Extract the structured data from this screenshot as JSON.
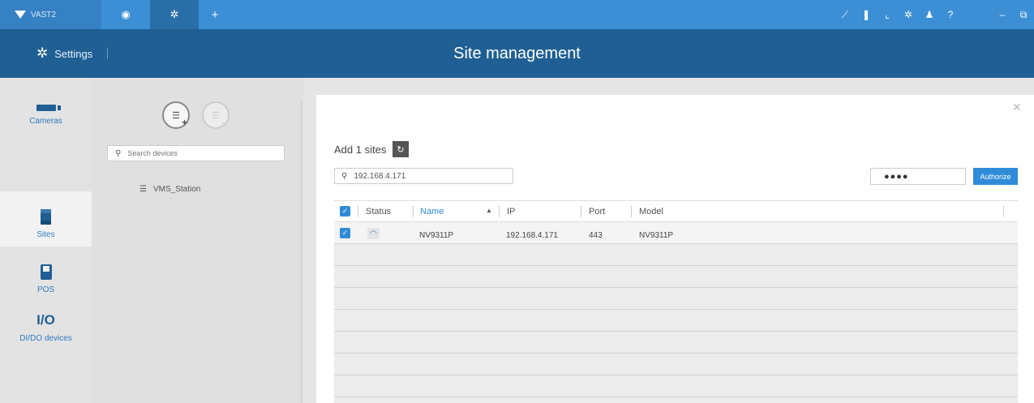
{
  "app": {
    "name": "VAST2"
  },
  "topbar": {
    "tabs": [
      {
        "icon": "eye-icon",
        "glyph": "◉"
      },
      {
        "icon": "gear-icon",
        "glyph": "✲"
      },
      {
        "icon": "plus-icon",
        "glyph": "+"
      }
    ],
    "right_icons": [
      {
        "icon": "network-status-icon",
        "glyph": "⟋"
      },
      {
        "icon": "alarm-icon",
        "glyph": "❚"
      },
      {
        "icon": "chart-icon",
        "glyph": "⌞"
      },
      {
        "icon": "settings-icon",
        "glyph": "✲"
      },
      {
        "icon": "user-icon",
        "glyph": "♟"
      },
      {
        "icon": "help-icon",
        "glyph": "?"
      },
      {
        "icon": "minimize-icon",
        "glyph": "–"
      },
      {
        "icon": "restore-icon",
        "glyph": "⧉"
      }
    ]
  },
  "header": {
    "section": "Settings",
    "title": "Site management"
  },
  "nav": [
    {
      "key": "cameras",
      "label": "Cameras",
      "selected": false
    },
    {
      "key": "sites",
      "label": "Sites",
      "selected": true
    },
    {
      "key": "pos",
      "label": "POS",
      "selected": false
    },
    {
      "key": "io",
      "label": "DI/DO devices",
      "icon_text": "I/O",
      "selected": false
    }
  ],
  "tree": {
    "search_placeholder": "Search devices",
    "items": [
      {
        "label": "VMS_Station"
      }
    ]
  },
  "dialog": {
    "title": "Add 1 sites",
    "ip_query": "192.168.4.171",
    "password_mask": "●●●●",
    "authorize_label": "Authorize",
    "columns": {
      "status": "Status",
      "name": "Name",
      "ip": "IP",
      "port": "Port",
      "model": "Model"
    },
    "sort": {
      "column": "name",
      "direction": "asc"
    },
    "rows": [
      {
        "checked": true,
        "status": "connecting",
        "name": "NV9311P",
        "ip": "192.168.4.171",
        "port": "443",
        "model": "NV9311P"
      }
    ]
  },
  "colors": {
    "topbar": "#3c8fd5",
    "header": "#1f5f93",
    "accent": "#2f8bd8"
  }
}
